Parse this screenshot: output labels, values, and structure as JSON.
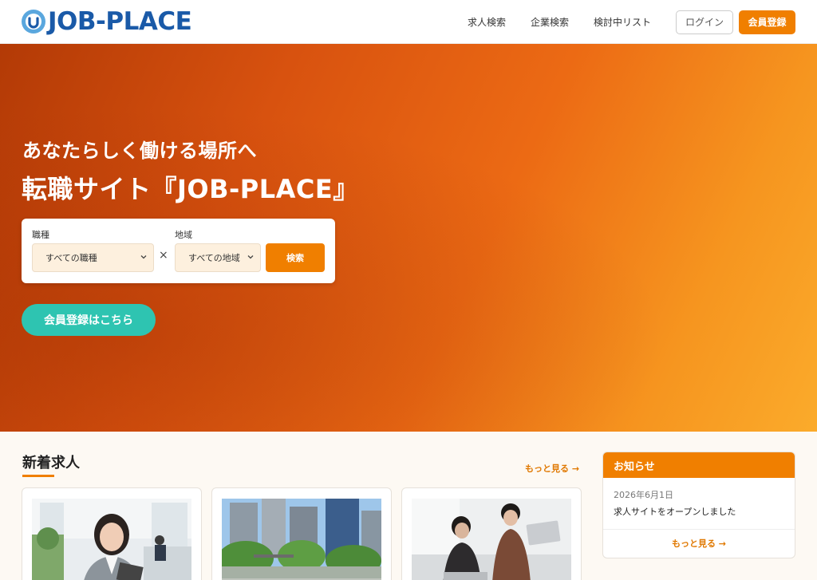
{
  "header": {
    "logo_text": "JOB-PLACE",
    "nav": [
      "求人検索",
      "企業検索",
      "検討中リスト"
    ],
    "login_label": "ログイン",
    "register_label": "会員登録"
  },
  "hero": {
    "subtitle": "あなたらしく働ける場所へ",
    "title": "転職サイト『JOB-PLACE』",
    "search": {
      "job_label": "職種",
      "job_value": "すべての職種",
      "area_label": "地域",
      "area_value": "すべての地域",
      "times": "×",
      "button_label": "検索"
    },
    "signup_label": "会員登録はこちら"
  },
  "new_jobs": {
    "title": "新着求人",
    "more_label": "もっと見る →"
  },
  "notice": {
    "title": "お知らせ",
    "date": "2026年6月1日",
    "text": "求人サイトをオープンしました",
    "more_label": "もっと見る →"
  },
  "colors": {
    "accent": "#f07f00",
    "teal": "#2ec4b1",
    "brand": "#1a5aa8"
  }
}
